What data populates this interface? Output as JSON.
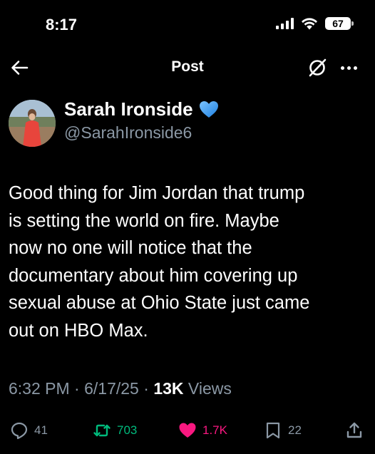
{
  "status_bar": {
    "time": "8:17",
    "battery": "67"
  },
  "nav": {
    "title": "Post"
  },
  "author": {
    "name": "Sarah Ironside",
    "handle": "@SarahIronside6",
    "badge_icon": "blue-heart-icon"
  },
  "tweet": {
    "text_lines": [
      "Good thing for Jim Jordan that trump",
      "is setting the world on fire. Maybe",
      "now no one will notice that the",
      "documentary about him covering up",
      "sexual abuse at Ohio State just came",
      "out on HBO Max."
    ]
  },
  "meta": {
    "time": "6:32 PM",
    "separator": "·",
    "date": "6/17/25",
    "views_count": "13K",
    "views_label": "Views"
  },
  "actions": {
    "replies": "41",
    "reposts": "703",
    "likes": "1.7K",
    "bookmarks": "22"
  },
  "colors": {
    "background": "#000000",
    "text": "#ffffff",
    "muted": "#8b98a5",
    "repost": "#00ba7c",
    "like": "#f91880",
    "badge": "#1d9bf0"
  }
}
